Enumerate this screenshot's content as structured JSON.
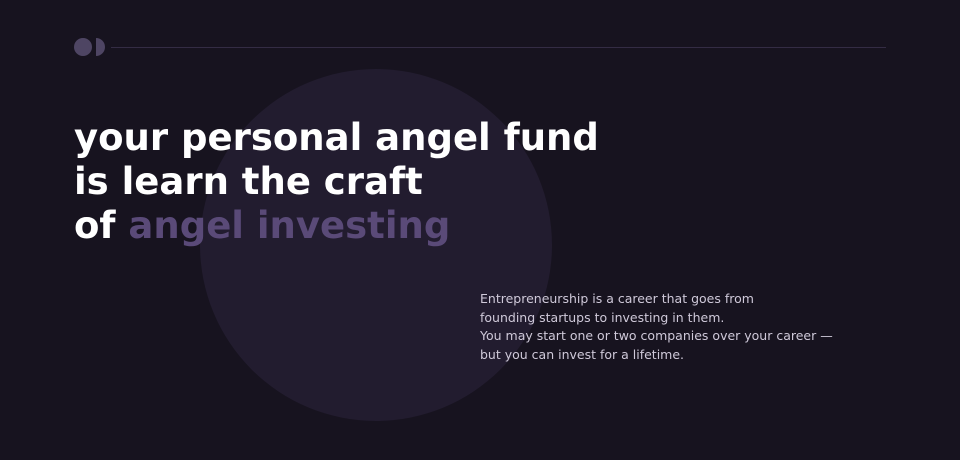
{
  "colors": {
    "background": "#17131f",
    "circle": "#221c2f",
    "headline": "#ffffff",
    "accent": "#5a4a78",
    "body_text": "#cfc9d9",
    "logo": "#4e4563"
  },
  "header": {
    "logo_icon": "dot-and-half-circle-logo-icon"
  },
  "hero": {
    "headline_line1": "your personal angel fund",
    "headline_line2": "is learn the craft",
    "headline_line3_prefix": "of",
    "headline_line3_accent": "angel investing"
  },
  "intro": {
    "line1": "Entrepreneurship is a career that goes from",
    "line2": "founding startups to investing in them.",
    "line3": "You may start one or two companies over your career —",
    "line4": "but you can invest for a lifetime."
  }
}
